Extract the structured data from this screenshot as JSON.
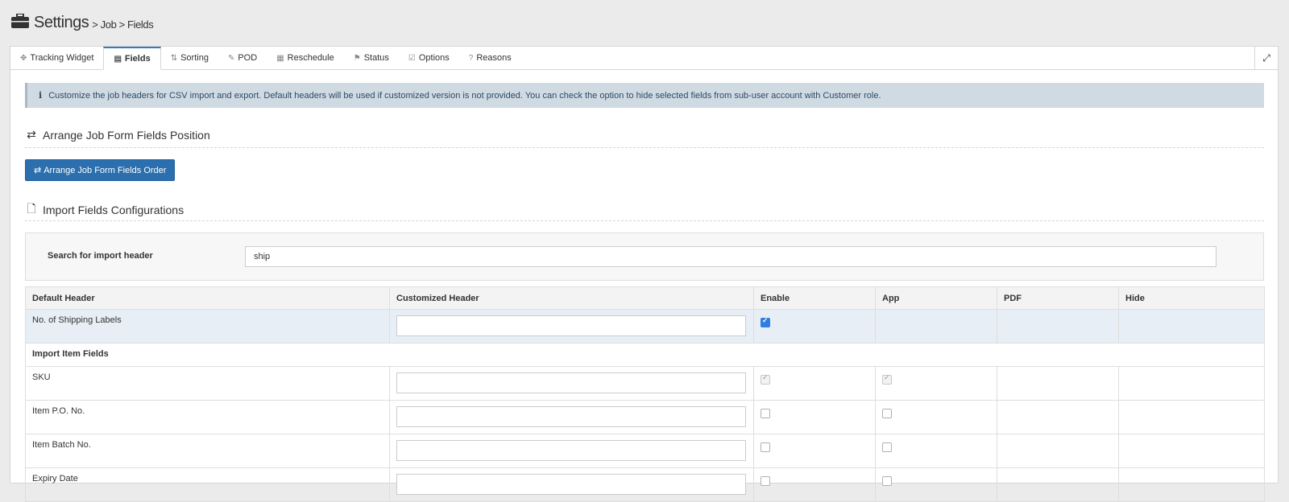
{
  "header": {
    "title": "Settings",
    "breadcrumb": "> Job > Fields"
  },
  "tabs": [
    {
      "label": "Tracking Widget",
      "icon": "crosshair-icon"
    },
    {
      "label": "Fields",
      "icon": "list-icon",
      "active": true
    },
    {
      "label": "Sorting",
      "icon": "sort-icon"
    },
    {
      "label": "POD",
      "icon": "edit-icon"
    },
    {
      "label": "Reschedule",
      "icon": "calendar-icon"
    },
    {
      "label": "Status",
      "icon": "flag-icon"
    },
    {
      "label": "Options",
      "icon": "checkbox-icon"
    },
    {
      "label": "Reasons",
      "icon": "question-icon"
    }
  ],
  "info": {
    "text": "Customize the job headers for CSV import and export. Default headers will be used if customized version is not provided. You can check the option to hide selected fields from sub-user account with Customer role."
  },
  "arrange": {
    "section_title": "Arrange Job Form Fields Position",
    "button_label": "Arrange Job Form Fields Order"
  },
  "import": {
    "section_title": "Import Fields Configurations",
    "search_label": "Search for import header",
    "search_value": "ship"
  },
  "table": {
    "columns": [
      "Default Header",
      "Customized Header",
      "Enable",
      "App",
      "PDF",
      "Hide"
    ],
    "rows": [
      {
        "label": "No. of Shipping Labels",
        "enable": "checked",
        "app": "none"
      },
      {
        "group": "Import Item Fields"
      },
      {
        "label": "SKU",
        "enable": "grey",
        "app": "grey"
      },
      {
        "label": "Item P.O. No.",
        "enable": "unchecked",
        "app": "unchecked"
      },
      {
        "label": "Item Batch No.",
        "enable": "unchecked",
        "app": "unchecked"
      },
      {
        "label": "Expiry Date",
        "enable": "unchecked",
        "app": "unchecked"
      }
    ]
  },
  "colors": {
    "accent": "#2c6fae",
    "info_bg": "#d0dae3",
    "highlight_row": "#e7eef5"
  }
}
